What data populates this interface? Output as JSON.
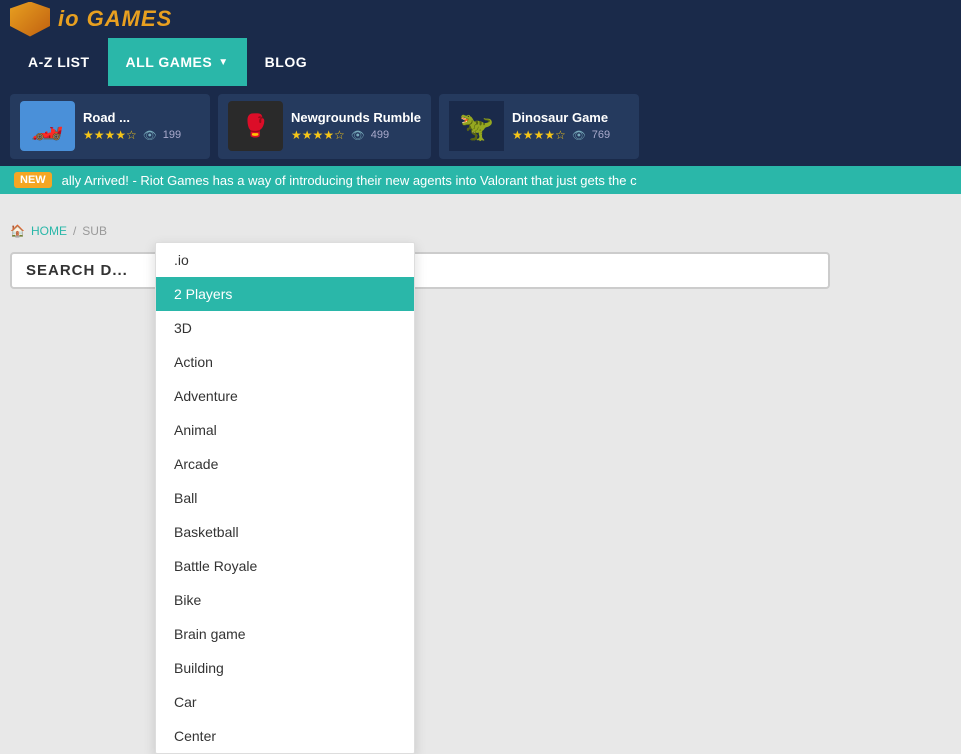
{
  "site": {
    "title": "io GAMES",
    "logo_emoji": "🛡️"
  },
  "nav": {
    "items": [
      {
        "label": "A-Z LIST",
        "active": false
      },
      {
        "label": "ALL GAMES",
        "active": true,
        "has_arrow": true
      },
      {
        "label": "BLOG",
        "active": false
      }
    ]
  },
  "banner_games": [
    {
      "title": "Road ...",
      "stars": 4,
      "views": 199,
      "emoji": "🏎️",
      "bg": "#4a90d9"
    },
    {
      "title": "Newgrounds Rumble",
      "stars": 4,
      "views": 499,
      "emoji": "🥊",
      "bg": "#2a2a2a"
    },
    {
      "title": "Dinosaur Game",
      "stars": 4,
      "views": 769,
      "emoji": "🦖",
      "bg": "#1a2a4a"
    }
  ],
  "ticker": {
    "new_label": "NEW",
    "text": "ally Arrived! - Riot Games has a way of introducing their new agents into Valorant that just gets the c"
  },
  "breadcrumb": {
    "home": "HOME",
    "sub": "SUB"
  },
  "search": {
    "placeholder": "SEARCH D..."
  },
  "dropdown": {
    "items": [
      {
        "label": ".io",
        "selected": false
      },
      {
        "label": "2 Players",
        "selected": true
      },
      {
        "label": "3D",
        "selected": false
      },
      {
        "label": "Action",
        "selected": false
      },
      {
        "label": "Adventure",
        "selected": false
      },
      {
        "label": "Animal",
        "selected": false
      },
      {
        "label": "Arcade",
        "selected": false
      },
      {
        "label": "Ball",
        "selected": false
      },
      {
        "label": "Basketball",
        "selected": false
      },
      {
        "label": "Battle Royale",
        "selected": false
      },
      {
        "label": "Bike",
        "selected": false
      },
      {
        "label": "Brain game",
        "selected": false
      },
      {
        "label": "Building",
        "selected": false
      },
      {
        "label": "Car",
        "selected": false
      },
      {
        "label": "Center",
        "selected": false
      }
    ]
  }
}
